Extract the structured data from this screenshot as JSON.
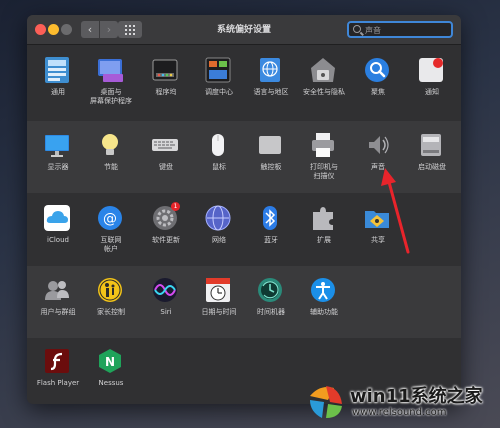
{
  "window": {
    "title": "系统偏好设置"
  },
  "toolbar": {
    "back": "‹",
    "forward": "›"
  },
  "search": {
    "placeholder": "声音",
    "value": ""
  },
  "rows": [
    {
      "panes": [
        {
          "label": "通用",
          "icon": "general-icon"
        },
        {
          "label": "桌面与\n屏幕保护程序",
          "icon": "desktop-icon"
        },
        {
          "label": "程序坞",
          "icon": "dock-icon"
        },
        {
          "label": "调度中心",
          "icon": "mission-control-icon"
        },
        {
          "label": "语言与地区",
          "icon": "language-region-icon"
        },
        {
          "label": "安全性与隐私",
          "icon": "security-privacy-icon"
        },
        {
          "label": "聚焦",
          "icon": "spotlight-icon"
        },
        {
          "label": "通知",
          "icon": "notifications-icon"
        }
      ]
    },
    {
      "panes": [
        {
          "label": "显示器",
          "icon": "displays-icon"
        },
        {
          "label": "节能",
          "icon": "energy-saver-icon"
        },
        {
          "label": "键盘",
          "icon": "keyboard-icon"
        },
        {
          "label": "鼠标",
          "icon": "mouse-icon"
        },
        {
          "label": "触控板",
          "icon": "trackpad-icon"
        },
        {
          "label": "打印机与\n扫描仪",
          "icon": "printers-scanners-icon"
        },
        {
          "label": "声音",
          "icon": "sound-icon"
        },
        {
          "label": "启动磁盘",
          "icon": "startup-disk-icon"
        }
      ]
    },
    {
      "panes": [
        {
          "label": "iCloud",
          "icon": "icloud-icon"
        },
        {
          "label": "互联网\n帐户",
          "icon": "internet-accounts-icon"
        },
        {
          "label": "软件更新",
          "icon": "software-update-icon",
          "badge": "1"
        },
        {
          "label": "网络",
          "icon": "network-icon"
        },
        {
          "label": "蓝牙",
          "icon": "bluetooth-icon"
        },
        {
          "label": "扩展",
          "icon": "extensions-icon"
        },
        {
          "label": "共享",
          "icon": "sharing-icon"
        }
      ]
    },
    {
      "panes": [
        {
          "label": "用户与群组",
          "icon": "users-groups-icon"
        },
        {
          "label": "家长控制",
          "icon": "parental-controls-icon"
        },
        {
          "label": "Siri",
          "icon": "siri-icon"
        },
        {
          "label": "日期与时间",
          "icon": "date-time-icon"
        },
        {
          "label": "时间机器",
          "icon": "time-machine-icon"
        },
        {
          "label": "辅助功能",
          "icon": "accessibility-icon"
        }
      ]
    },
    {
      "panes": [
        {
          "label": "Flash Player",
          "icon": "flash-player-icon"
        },
        {
          "label": "Nessus",
          "icon": "nessus-icon"
        }
      ]
    }
  ],
  "watermark": {
    "title": "win11系统之家",
    "url": "www.relsound.com"
  }
}
